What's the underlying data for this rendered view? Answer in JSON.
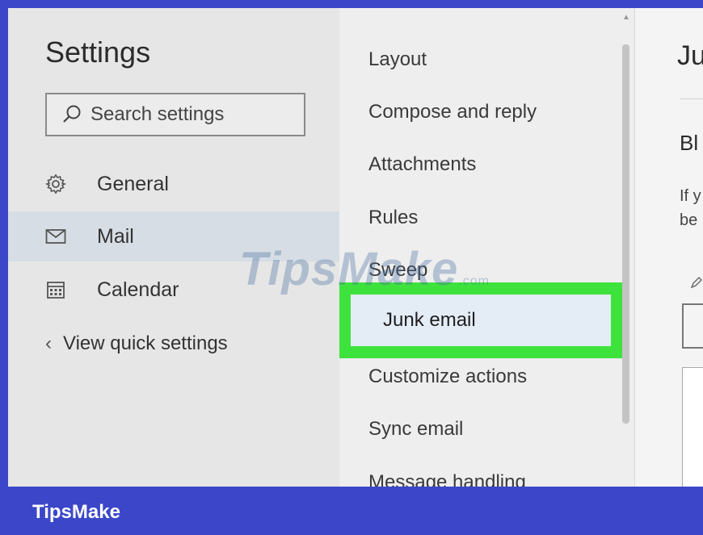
{
  "settings_panel": {
    "title": "Settings",
    "search_placeholder": "Search settings",
    "nav": [
      {
        "label": "General",
        "icon": "gear-icon",
        "active": false
      },
      {
        "label": "Mail",
        "icon": "mail-icon",
        "active": true
      },
      {
        "label": "Calendar",
        "icon": "calendar-icon",
        "active": false
      }
    ],
    "quick_settings_label": "View quick settings"
  },
  "mail_options": {
    "items": [
      "Layout",
      "Compose and reply",
      "Attachments",
      "Rules",
      "Sweep",
      "Junk email",
      "Customize actions",
      "Sync email",
      "Message handling"
    ],
    "selected": "Junk email",
    "highlight_color": "#3ee23c"
  },
  "detail_pane": {
    "title": "Ju",
    "heading": "Bl",
    "line1": "If y",
    "line2": "be"
  },
  "watermark": {
    "main": "TipsMake",
    "suffix": ".com"
  },
  "footer": {
    "brand": "TipsMake",
    "color": "#3b47c8"
  }
}
